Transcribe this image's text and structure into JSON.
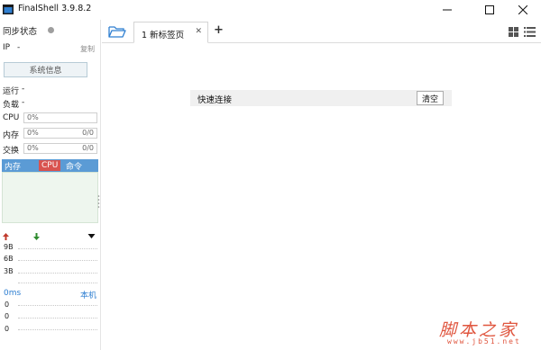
{
  "window": {
    "title": "FinalShell 3.9.8.2"
  },
  "sidebar": {
    "sync_status": "同步状态",
    "ip_label": "IP",
    "ip_value": "-",
    "copy": "复制",
    "sysinfo_button": "系统信息",
    "uptime_label": "运行",
    "uptime_value": "-",
    "load_label": "负载",
    "load_value": "-",
    "cpu_label": "CPU",
    "cpu_value": "0%",
    "mem_label": "内存",
    "mem_value": "0%",
    "mem_detail": "0/0",
    "swap_label": "交换",
    "swap_value": "0%",
    "swap_detail": "0/0",
    "process_tabs": [
      "内存",
      "CPU",
      "命令"
    ],
    "net_scale": [
      "9B",
      "6B",
      "3B"
    ],
    "ping_label": "0ms",
    "ping_host": "本机",
    "ping_values": [
      "0",
      "0",
      "0"
    ]
  },
  "tabs": {
    "items": [
      {
        "label": "1 新标签页"
      }
    ]
  },
  "main": {
    "quick_connect_label": "快速连接",
    "clear_button": "清空"
  },
  "watermark": {
    "text": "脚本之家",
    "url": "www.jb51.net"
  },
  "colors": {
    "accent_blue": "#5b9bd5",
    "cpu_red": "#d9534f",
    "status_dot": "#9e9e9e",
    "upload_arrow": "#c0392b",
    "download_arrow": "#2e8b2e",
    "folder_blue": "#2f7fd1",
    "watermark": "#e0563f"
  }
}
